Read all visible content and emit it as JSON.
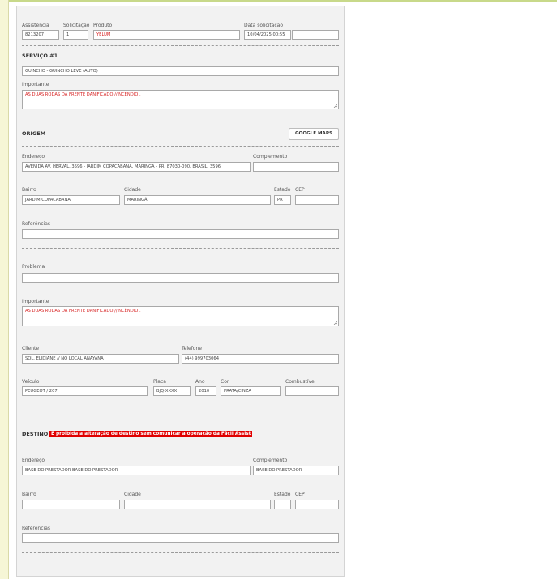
{
  "header": {
    "assistencia_label": "Assistência",
    "assistencia_value": "8213207",
    "solicitacao_label": "Solicitação",
    "solicitacao_value": "1",
    "produto_label": "Produto",
    "produto_value": "YELUM",
    "data_label": "Data solicitação",
    "data_value": "10/04/2025 00:55",
    "extra_value": ""
  },
  "servico": {
    "title": "SERVIÇO #1",
    "service_value": "GUINCHO - GUINCHO LEVE (AUTO)",
    "importante_label": "Importante",
    "importante_value": "AS DUAS RODAS DA FRENTE DANIFICADO //INCÊNDIO ."
  },
  "origem": {
    "title": "ORIGEM",
    "maps_button": "GOOGLE MAPS",
    "endereco_label": "Endereço",
    "endereco_value": "AVENIDA AV. HERVAL, 3596 - JARDIM COPACABANA, MARINGÁ - PR, 87030-090, BRASIL, 3596",
    "complemento_label": "Complemento",
    "complemento_value": "",
    "bairro_label": "Bairro",
    "bairro_value": "JARDIM COPACABANA",
    "cidade_label": "Cidade",
    "cidade_value": "MARINGÁ",
    "estado_label": "Estado",
    "estado_value": "PR",
    "cep_label": "CEP",
    "cep_value": "",
    "referencias_label": "Referências",
    "referencias_value": ""
  },
  "problema": {
    "problema_label": "Problema",
    "problema_value": "",
    "importante_label": "Importante",
    "importante_value": "AS DUAS RODAS DA FRENTE DANIFICADO //INCÊNDIO .",
    "cliente_label": "Cliente",
    "cliente_value": "SOL. ELIDIANE  // NO LOCAL ANAYANA",
    "telefone_label": "Telefone",
    "telefone_value": "(44) 999703064",
    "veiculo_label": "Veículo",
    "veiculo_value": "PEUGEOT / 207",
    "placa_label": "Placa",
    "placa_value": "BJQ-XXXX",
    "ano_label": "Ano",
    "ano_value": "2010",
    "cor_label": "Cor",
    "cor_value": "PRATA/CINZA",
    "combustivel_label": "Combustível",
    "combustivel_value": ""
  },
  "destino": {
    "title": "DESTINO",
    "warning": "É proibida a alteração de destino sem comunicar a operação da Fácil Assist",
    "endereco_label": "Endereço",
    "endereco_value": "BASE DO PRESTADOR BASE DO PRESTADOR",
    "complemento_label": "Complemento",
    "complemento_value": "BASE DO PRESTADOR",
    "bairro_label": "Bairro",
    "bairro_value": "",
    "cidade_label": "Cidade",
    "cidade_value": "",
    "estado_label": "Estado",
    "estado_value": "",
    "cep_label": "CEP",
    "cep_value": "",
    "referencias_label": "Referências",
    "referencias_value": ""
  },
  "colors": {
    "accent_red": "#d62020",
    "warning_bg": "#e00000"
  }
}
